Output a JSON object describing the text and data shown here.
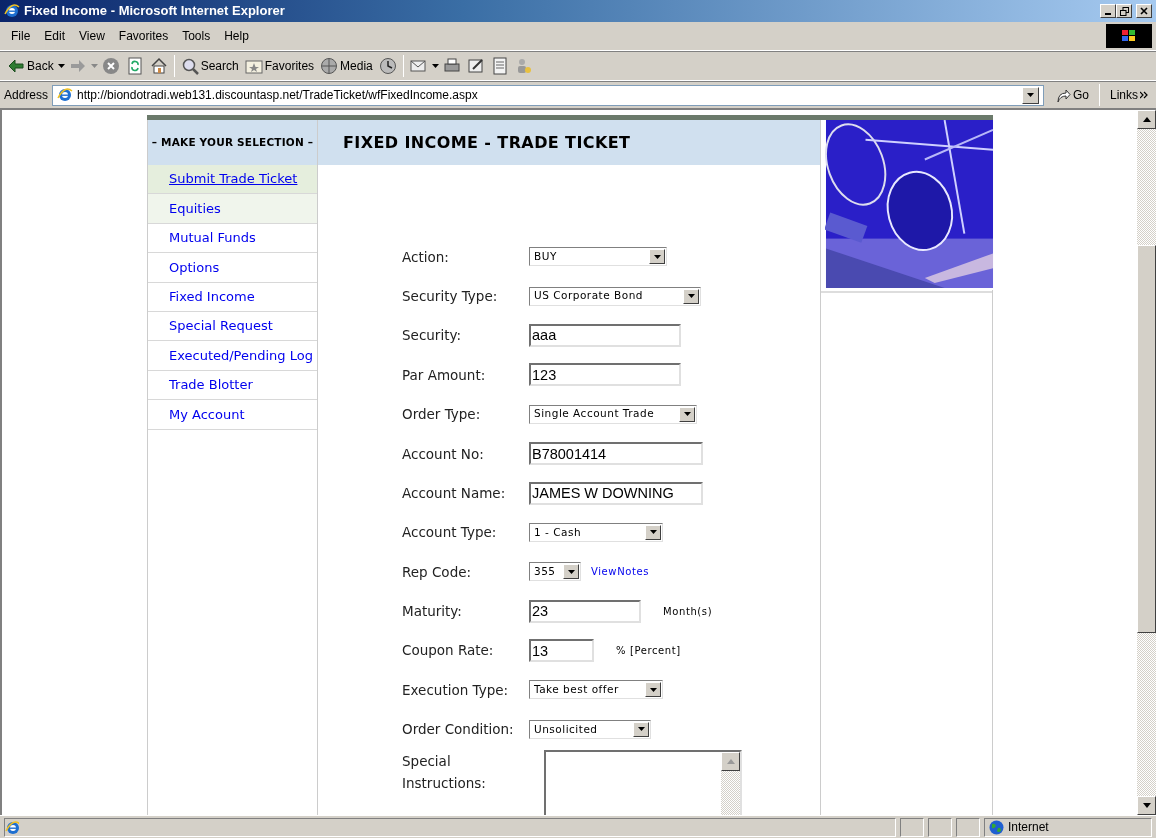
{
  "window": {
    "title": "Fixed Income - Microsoft Internet Explorer"
  },
  "menu": [
    "File",
    "Edit",
    "View",
    "Favorites",
    "Tools",
    "Help"
  ],
  "toolbar": [
    {
      "label": "Back"
    },
    {
      "label": "Search"
    },
    {
      "label": "Favorites"
    },
    {
      "label": "Media"
    }
  ],
  "address_bar": {
    "label": "Address",
    "url": "http://biondotradi.web131.discountasp.net/TradeTicket/wfFixedIncome.aspx",
    "go": "Go",
    "links": "Links"
  },
  "sidebar": {
    "title": "– MAKE YOUR SELECTION –",
    "items": [
      {
        "label": "Submit Trade Ticket",
        "selected": true,
        "shaded": true
      },
      {
        "label": "Equities",
        "selected": false,
        "shaded": true
      },
      {
        "label": "Mutual Funds",
        "selected": false,
        "shaded": false
      },
      {
        "label": "Options",
        "selected": false,
        "shaded": false
      },
      {
        "label": "Fixed Income",
        "selected": false,
        "shaded": false
      },
      {
        "label": "Special Request",
        "selected": false,
        "shaded": false
      },
      {
        "label": "Executed/Pending Log",
        "selected": false,
        "shaded": false
      },
      {
        "label": "Trade Blotter",
        "selected": false,
        "shaded": false
      },
      {
        "label": "My Account",
        "selected": false,
        "shaded": false
      }
    ]
  },
  "page_title": "FIXED INCOME - TRADE TICKET",
  "form": {
    "fields": [
      {
        "label": "Action:",
        "kind": "select",
        "value": "BUY"
      },
      {
        "label": "Security Type:",
        "kind": "select",
        "value": "US Corporate Bond"
      },
      {
        "label": "Security:",
        "kind": "text",
        "value": "aaa"
      },
      {
        "label": "Par Amount:",
        "kind": "text",
        "value": "123"
      },
      {
        "label": "Order Type:",
        "kind": "select",
        "value": "Single Account Trade"
      },
      {
        "label": "Account No:",
        "kind": "text",
        "value": "B78001414"
      },
      {
        "label": "Account Name:",
        "kind": "text",
        "value": "JAMES W DOWNING"
      },
      {
        "label": "Account Type:",
        "kind": "select",
        "value": "1 - Cash"
      },
      {
        "label": "Rep Code:",
        "kind": "select",
        "value": "355",
        "link": "ViewNotes"
      },
      {
        "label": "Maturity:",
        "kind": "text",
        "value": "23",
        "unit": "Month(s)"
      },
      {
        "label": "Coupon Rate:",
        "kind": "text",
        "value": "13",
        "unit": "% [Percent]"
      },
      {
        "label": "Execution Type:",
        "kind": "select",
        "value": "Take best offer"
      },
      {
        "label": "Order Condition:",
        "kind": "select",
        "value": "Unsolicited"
      },
      {
        "label": "Special Instructions:",
        "kind": "textarea"
      }
    ]
  },
  "status_bar": {
    "zone": "Internet"
  }
}
